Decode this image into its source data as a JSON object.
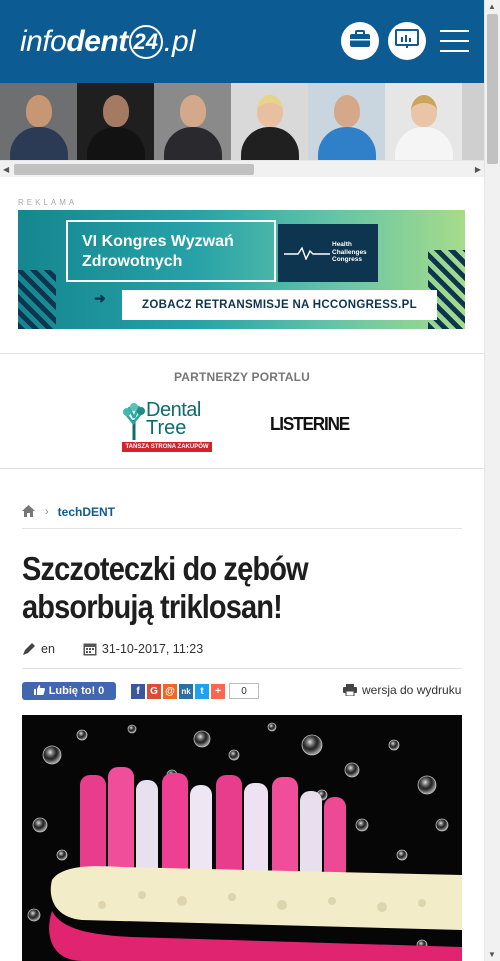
{
  "header": {
    "logo_info": "info",
    "logo_dent": "dent",
    "logo_24": "24",
    "logo_pl": ".pl",
    "bg_color": "#0d5b93"
  },
  "ad": {
    "label": "REKLAMA",
    "title_line1": "VI Kongres Wyzwań",
    "title_line2": "Zdrowotnych",
    "logo_text": [
      "Health",
      "Challenges",
      "Congress"
    ],
    "cta": "ZOBACZ RETRANSMISJE NA HCCONGRESS.PL"
  },
  "partners": {
    "title": "PARTNERZY PORTALU",
    "dentaltree_line1": "Dental",
    "dentaltree_line2": "Tree",
    "dentaltree_tag": "TAŃSZA STRONA ZAKUPÓW",
    "listerine": "LISTERINE"
  },
  "breadcrumb": {
    "sep": "›",
    "category": "techDENT"
  },
  "article": {
    "title": "Szczoteczki do zębów absorbują triklosan!",
    "author": "en",
    "date": "31-10-2017, 11:23"
  },
  "social": {
    "like_label": "Lubię to! 0",
    "share_count": "0",
    "print_label": "wersja do wydruku",
    "share_icons": [
      {
        "letter": "f",
        "color": "#3b5998"
      },
      {
        "letter": "G",
        "color": "#dd4b39"
      },
      {
        "letter": "@",
        "color": "#f26522"
      },
      {
        "letter": "nk",
        "color": "#2a70a3"
      },
      {
        "letter": "t",
        "color": "#1da1f2"
      },
      {
        "letter": "+",
        "color": "#ff6550"
      }
    ]
  }
}
